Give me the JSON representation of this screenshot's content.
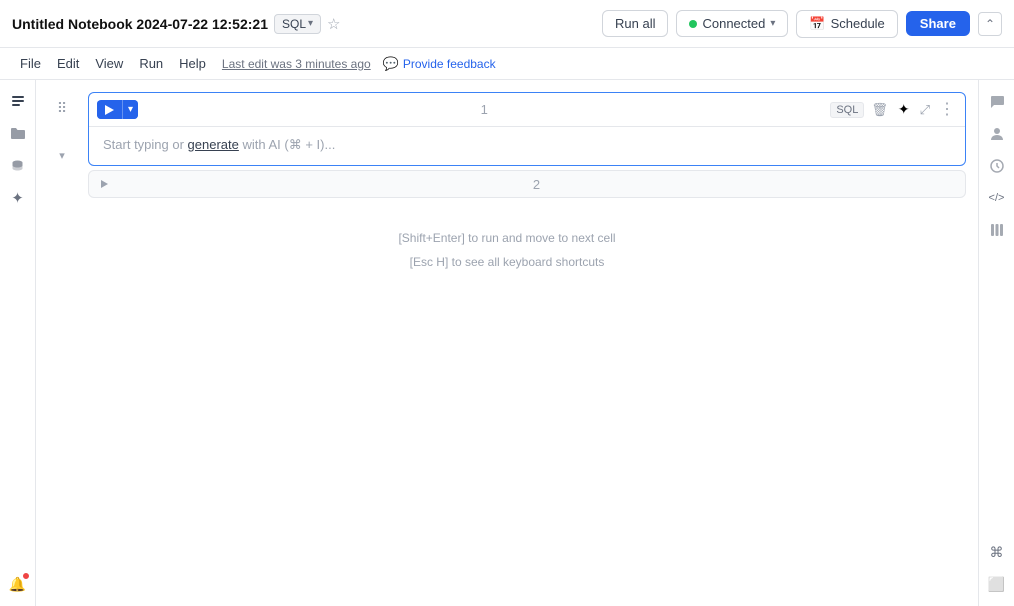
{
  "header": {
    "title": "Untitled Notebook 2024-07-22 12:52:21",
    "sql_badge": "SQL",
    "run_all_label": "Run all",
    "connected_label": "Connected",
    "schedule_label": "Schedule",
    "share_label": "Share",
    "last_edit": "Last edit was 3 minutes ago",
    "feedback_label": "Provide feedback",
    "collapse_icon": "⌃"
  },
  "menu": {
    "items": [
      "File",
      "Edit",
      "View",
      "Run",
      "Help"
    ]
  },
  "left_sidebar": {
    "icons": [
      {
        "name": "notebook-icon",
        "glyph": "☰"
      },
      {
        "name": "folder-icon",
        "glyph": "🗁"
      },
      {
        "name": "database-icon",
        "glyph": "⬡"
      },
      {
        "name": "ai-icon",
        "glyph": "✦"
      }
    ]
  },
  "right_sidebar": {
    "icons": [
      {
        "name": "comment-icon",
        "glyph": "💬"
      },
      {
        "name": "user-icon",
        "glyph": "👤"
      },
      {
        "name": "history-icon",
        "glyph": "🕐"
      },
      {
        "name": "code-icon",
        "glyph": "</>"
      },
      {
        "name": "library-icon",
        "glyph": "▮▮▮"
      }
    ],
    "bottom_icons": [
      {
        "name": "keyboard-icon",
        "glyph": "⌘"
      },
      {
        "name": "layout-icon",
        "glyph": "⬜"
      }
    ]
  },
  "cells": [
    {
      "id": 1,
      "number": "1",
      "type": "SQL",
      "placeholder": "Start typing or generate with AI (⌘ + I)...",
      "active": true
    },
    {
      "id": 2,
      "number": "2",
      "active": false
    }
  ],
  "hints": {
    "line1": "[Shift+Enter] to run and move to next cell",
    "line2": "[Esc H] to see all keyboard shortcuts"
  }
}
